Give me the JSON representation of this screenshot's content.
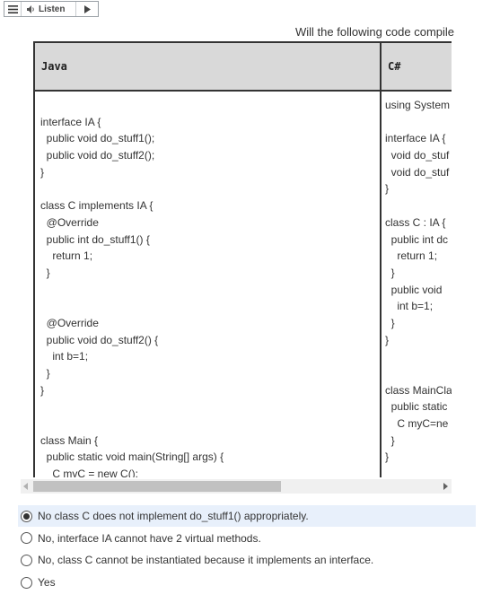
{
  "toolbar": {
    "listen_label": "Listen"
  },
  "question": {
    "title": "Will the following code compile"
  },
  "table": {
    "java_header": "Java",
    "csharp_header": "C#",
    "java_lines": [
      "",
      "interface IA {",
      "  public void do_stuff1();",
      "  public void do_stuff2();",
      "}",
      "",
      "class C implements IA {",
      "  @Override",
      "  public int do_stuff1() {",
      "    return 1;",
      "  }",
      "",
      "",
      "  @Override",
      "  public void do_stuff2() {",
      "    int b=1;",
      "  }",
      "}",
      "",
      "",
      "class Main {",
      "  public static void main(String[] args) {",
      "    C myC = new C();",
      "  }",
      "}"
    ],
    "csharp_lines": [
      "using System",
      "",
      "interface IA {",
      "  void do_stuf",
      "  void do_stuf",
      "}",
      "",
      "class C : IA {",
      "  public int dc",
      "    return 1;",
      "  }",
      "  public void",
      "    int b=1;",
      "  }",
      "}",
      "",
      "",
      "class MainCla",
      "  public static",
      "    C myC=ne",
      "  }",
      "}"
    ]
  },
  "options": [
    {
      "label": "No class C does not implement do_stuff1() appropriately.",
      "selected": true
    },
    {
      "label": "No, interface IA cannot have 2 virtual methods.",
      "selected": false
    },
    {
      "label": "No, class C cannot be instantiated because it implements an interface.",
      "selected": false
    },
    {
      "label": "Yes",
      "selected": false
    }
  ]
}
